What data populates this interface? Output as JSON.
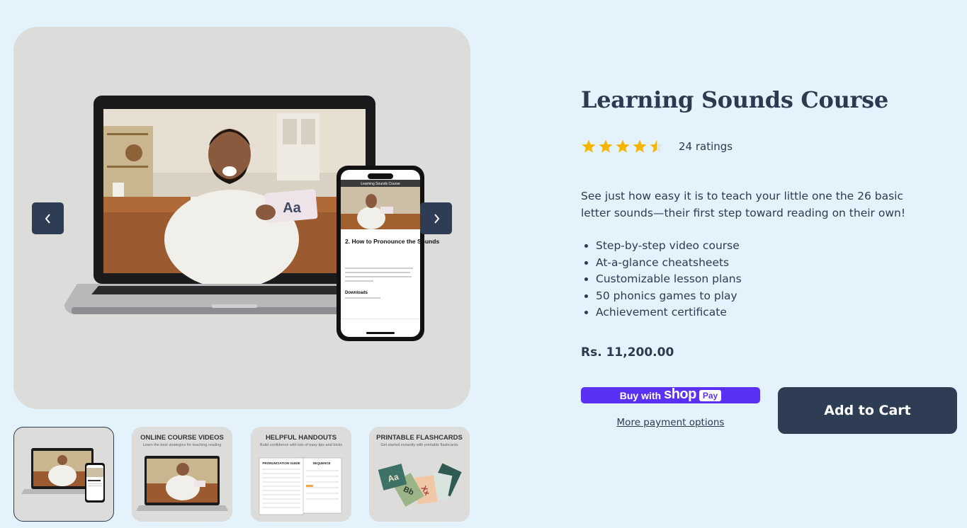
{
  "product": {
    "title": "Learning Sounds Course",
    "rating_value": 4.5,
    "rating_max": 5,
    "rating_count_label": "24 ratings",
    "description": "See just how easy it is to teach your little one the 26 basic letter sounds—their first step toward reading on their own!",
    "features": [
      "Step-by-step video course",
      "At-a-glance cheatsheets",
      "Customizable lesson plans",
      "50 phonics games to play",
      "Achievement certificate"
    ],
    "price": "Rs. 11,200.00"
  },
  "buttons": {
    "shop_pay_buy": "Buy with",
    "shop_pay_shop": "shop",
    "shop_pay_pay": "Pay",
    "more_payment_options": "More payment options",
    "add_to_cart": "Add to Cart"
  },
  "gallery": {
    "main_card_text": "Aa",
    "phone_header": "Learning Sounds Course",
    "phone_lesson_title": "2. How to Pronounce the Sounds",
    "phone_downloads": "Downloads",
    "thumbnails": [
      {
        "title": "",
        "subtitle": ""
      },
      {
        "title": "ONLINE COURSE VIDEOS",
        "subtitle": "Learn the best strategies for teaching reading"
      },
      {
        "title": "HELPFUL HANDOUTS",
        "subtitle": "Build confidence with lots of easy tips and tricks"
      },
      {
        "title": "PRINTABLE FLASHCARDS",
        "subtitle": "Get started instantly with printable flashcards"
      }
    ],
    "handout_doc_title": "PRONUNCIATION GUIDE",
    "handout_doc_title2": "SEQUENCE",
    "flashcards": [
      "Aa",
      "Bb",
      "Xx"
    ]
  },
  "colors": {
    "background": "#e4f2fc",
    "primary": "#2e3c54",
    "shop_pay": "#5a31f4",
    "star": "#f6b500"
  }
}
